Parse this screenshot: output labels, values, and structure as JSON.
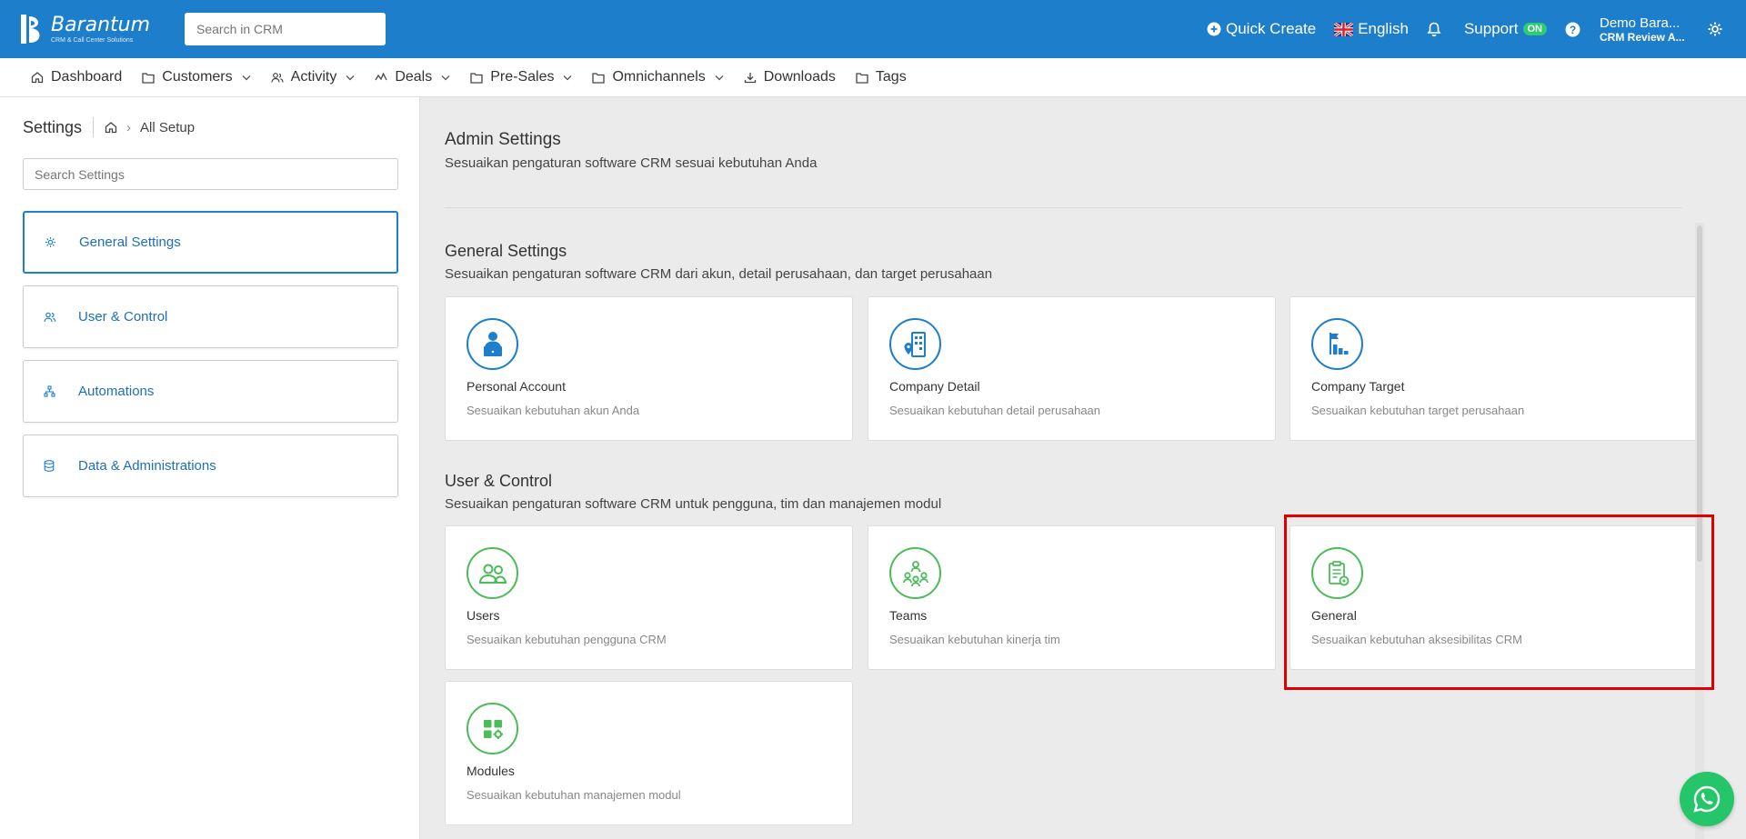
{
  "app": {
    "logo_name": "Barantum",
    "logo_tagline": "CRM & Call Center Solutions"
  },
  "header": {
    "search_placeholder": "Search in CRM",
    "quick_create": "Quick Create",
    "language": "English",
    "support": "Support",
    "support_badge": "ON",
    "user_name": "Demo Bara...",
    "user_role": "CRM Review A..."
  },
  "nav": {
    "items": [
      {
        "label": "Dashboard",
        "icon": "home-icon",
        "has_dropdown": false
      },
      {
        "label": "Customers",
        "icon": "folder-icon",
        "has_dropdown": true
      },
      {
        "label": "Activity",
        "icon": "people-icon",
        "has_dropdown": true
      },
      {
        "label": "Deals",
        "icon": "chart-icon",
        "has_dropdown": true
      },
      {
        "label": "Pre-Sales",
        "icon": "folder-icon",
        "has_dropdown": true
      },
      {
        "label": "Omnichannels",
        "icon": "folder-icon",
        "has_dropdown": true
      },
      {
        "label": "Downloads",
        "icon": "download-icon",
        "has_dropdown": false
      },
      {
        "label": "Tags",
        "icon": "folder-icon",
        "has_dropdown": false
      }
    ]
  },
  "sidebar": {
    "title": "Settings",
    "breadcrumb": "All Setup",
    "search_placeholder": "Search Settings",
    "items": [
      {
        "label": "General Settings",
        "icon": "gear-icon",
        "active": true
      },
      {
        "label": "User & Control",
        "icon": "users-icon",
        "active": false
      },
      {
        "label": "Automations",
        "icon": "hierarchy-icon",
        "active": false
      },
      {
        "label": "Data & Administrations",
        "icon": "database-icon",
        "active": false
      }
    ]
  },
  "main": {
    "title": "Admin Settings",
    "subtitle": "Sesuaikan pengaturan software CRM sesuai kebutuhan Anda",
    "sections": [
      {
        "title": "General Settings",
        "subtitle": "Sesuaikan pengaturan software CRM dari akun, detail perusahaan, dan target perusahaan",
        "cards": [
          {
            "title": "Personal Account",
            "desc": "Sesuaikan kebutuhan akun Anda",
            "icon": "person-laptop-icon",
            "color": "#1d7ecb"
          },
          {
            "title": "Company Detail",
            "desc": "Sesuaikan kebutuhan detail perusahaan",
            "icon": "building-icon",
            "color": "#1d7ecb"
          },
          {
            "title": "Company Target",
            "desc": "Sesuaikan kebutuhan target perusahaan",
            "icon": "target-flag-icon",
            "color": "#1d7ecb"
          }
        ]
      },
      {
        "title": "User & Control",
        "subtitle": "Sesuaikan pengaturan software CRM untuk pengguna, tim dan manajemen modul",
        "cards": [
          {
            "title": "Users",
            "desc": "Sesuaikan kebutuhan pengguna CRM",
            "icon": "users-icon",
            "color": "#4cbb5a"
          },
          {
            "title": "Teams",
            "desc": "Sesuaikan kebutuhan kinerja tim",
            "icon": "team-icon",
            "color": "#4cbb5a"
          },
          {
            "title": "General",
            "desc": "Sesuaikan kebutuhan aksesibilitas CRM",
            "icon": "clipboard-gear-icon",
            "color": "#4cbb5a"
          },
          {
            "title": "Modules",
            "desc": "Sesuaikan kebutuhan manajemen modul",
            "icon": "modules-icon",
            "color": "#4cbb5a"
          }
        ]
      }
    ]
  },
  "colors": {
    "primary": "#1d7ecb",
    "green": "#4cbb5a",
    "highlight": "#e00000",
    "whatsapp": "#25c66a"
  }
}
